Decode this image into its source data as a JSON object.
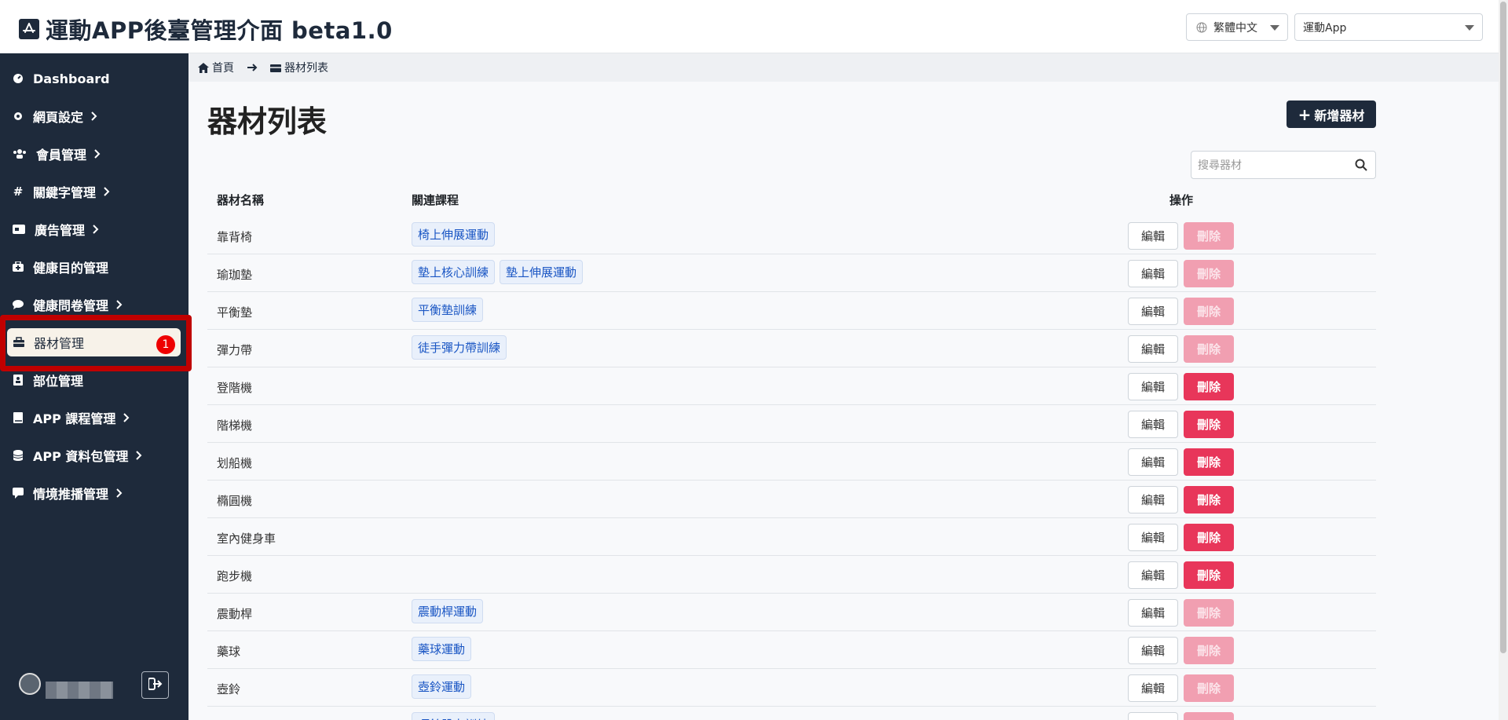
{
  "header": {
    "title": "運動APP後臺管理介面 beta1.0",
    "language": "繁體中文",
    "app": "運動App"
  },
  "sidebar": {
    "items": [
      {
        "label": "Dashboard",
        "icon": "dashboard-icon",
        "chevron": false
      },
      {
        "label": "網頁設定",
        "icon": "gear-icon",
        "chevron": true
      },
      {
        "label": "會員管理",
        "icon": "users-icon",
        "chevron": true
      },
      {
        "label": "關鍵字管理",
        "icon": "hashtag-icon",
        "chevron": true
      },
      {
        "label": "廣告管理",
        "icon": "ad-icon",
        "chevron": true
      },
      {
        "label": "健康目的管理",
        "icon": "medkit-icon",
        "chevron": false
      },
      {
        "label": "健康問卷管理",
        "icon": "comment-icon",
        "chevron": true
      },
      {
        "label": "器材管理",
        "icon": "toolbox-icon",
        "chevron": false,
        "active": true,
        "badge": "1"
      },
      {
        "label": "部位管理",
        "icon": "body-icon",
        "chevron": false
      },
      {
        "label": "APP 課程管理",
        "icon": "book-icon",
        "chevron": true
      },
      {
        "label": "APP 資料包管理",
        "icon": "database-icon",
        "chevron": true
      },
      {
        "label": "情境推播管理",
        "icon": "message-icon",
        "chevron": true
      }
    ]
  },
  "breadcrumb": {
    "home": "首頁",
    "current": "器材列表"
  },
  "main": {
    "title": "器材列表",
    "add_button": "新增器材",
    "search_placeholder": "搜尋器材",
    "columns": {
      "name": "器材名稱",
      "course": "關連課程",
      "operation": "操作"
    },
    "edit_label": "編輯",
    "delete_label": "刪除",
    "rows": [
      {
        "name": "靠背椅",
        "courses": [
          "椅上伸展運動"
        ],
        "delete_enabled": false
      },
      {
        "name": "瑜珈墊",
        "courses": [
          "墊上核心訓練",
          "墊上伸展運動"
        ],
        "delete_enabled": false
      },
      {
        "name": "平衡墊",
        "courses": [
          "平衡墊訓練"
        ],
        "delete_enabled": false
      },
      {
        "name": "彈力帶",
        "courses": [
          "徒手彈力帶訓練"
        ],
        "delete_enabled": false
      },
      {
        "name": "登階機",
        "courses": [],
        "delete_enabled": true
      },
      {
        "name": "階梯機",
        "courses": [],
        "delete_enabled": true
      },
      {
        "name": "划船機",
        "courses": [],
        "delete_enabled": true
      },
      {
        "name": "橢圓機",
        "courses": [],
        "delete_enabled": true
      },
      {
        "name": "室內健身車",
        "courses": [],
        "delete_enabled": true
      },
      {
        "name": "跑步機",
        "courses": [],
        "delete_enabled": true
      },
      {
        "name": "震動桿",
        "courses": [
          "震動桿運動"
        ],
        "delete_enabled": false
      },
      {
        "name": "藥球",
        "courses": [
          "藥球運動"
        ],
        "delete_enabled": false
      },
      {
        "name": "壺鈴",
        "courses": [
          "壺鈴運動"
        ],
        "delete_enabled": false
      },
      {
        "name": "",
        "courses": [
          "啞鈴肌力訓練"
        ],
        "delete_enabled": false
      }
    ]
  },
  "colors": {
    "sidebar_bg": "#1e2a3b",
    "primary": "#1e2a3b",
    "delete_enabled": "#e8365a",
    "delete_disabled": "#f19fb1",
    "tag_text": "#1a56c4",
    "highlight_border": "#c00000"
  }
}
